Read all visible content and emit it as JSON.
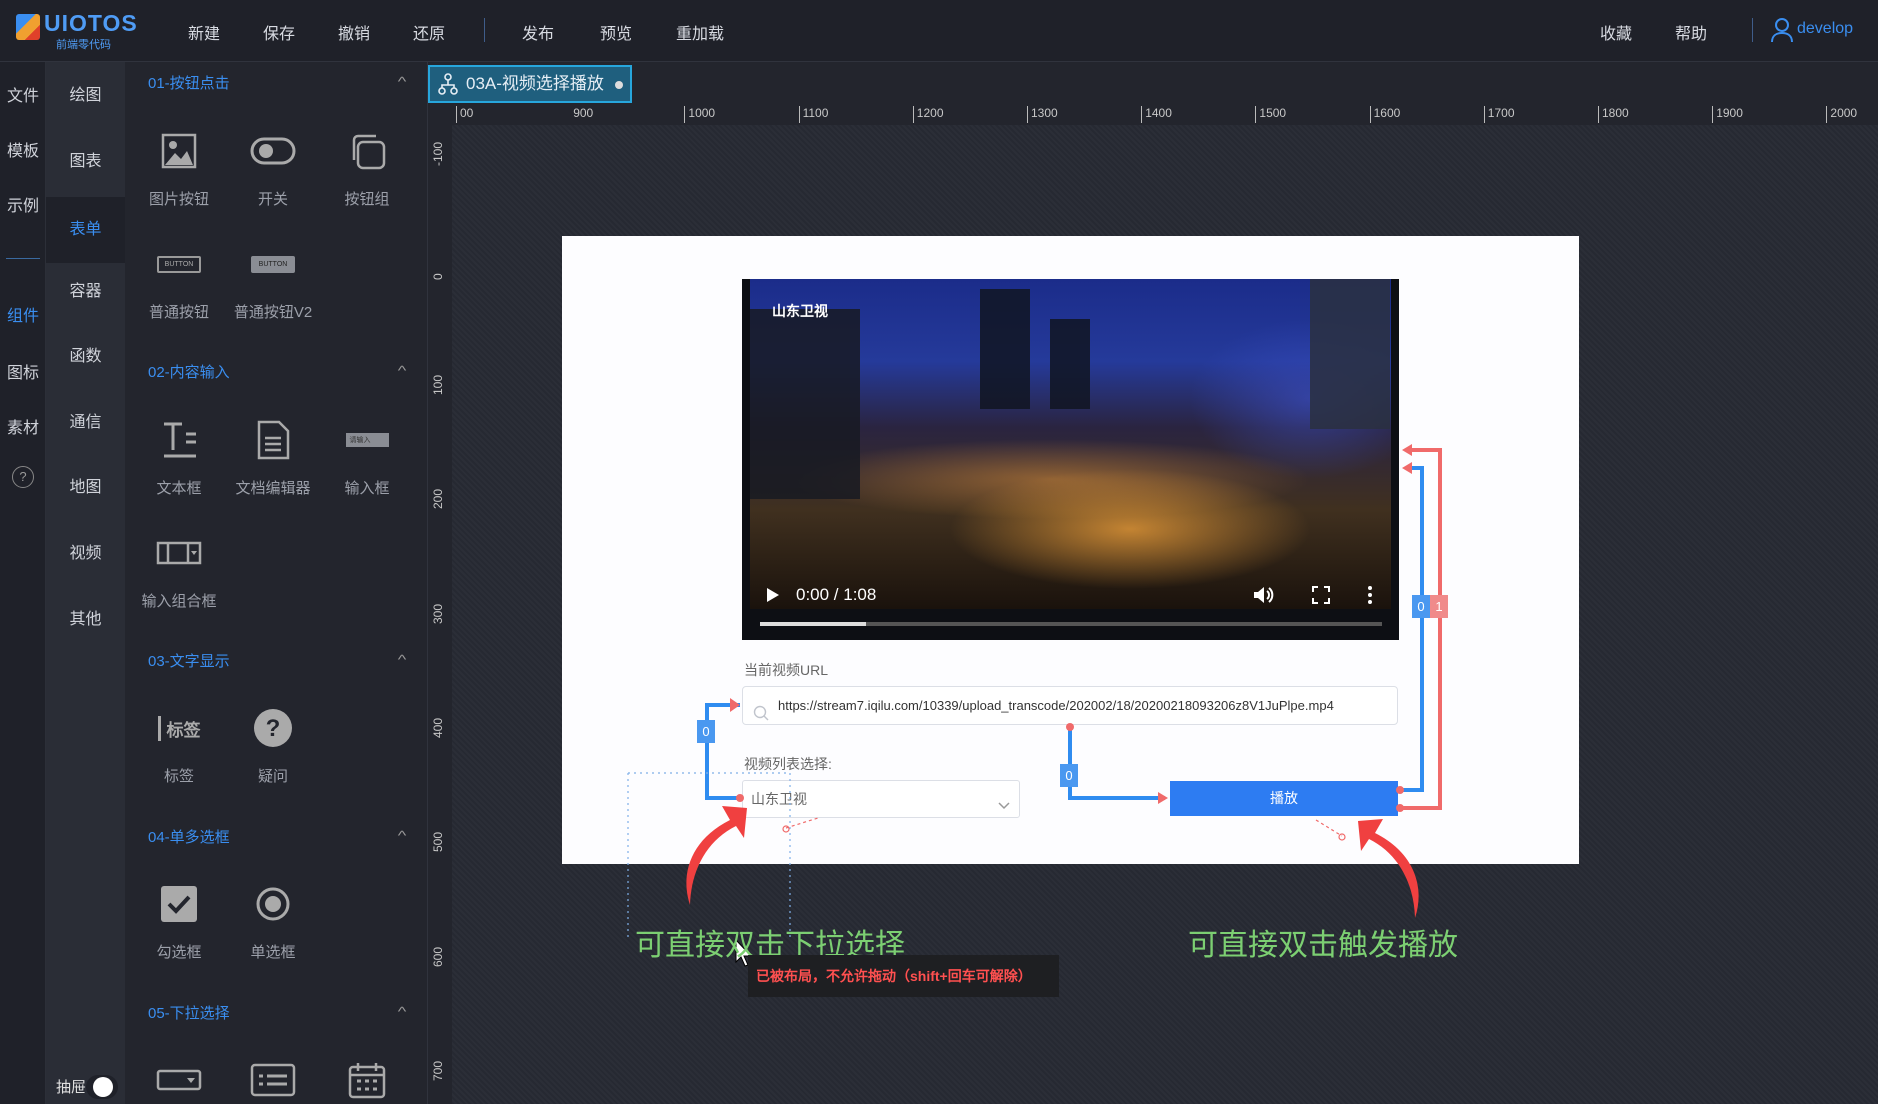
{
  "app": {
    "logo": "UIOTOS",
    "logo_sub": "前端零代码",
    "user": "develop"
  },
  "topmenu": [
    "新建",
    "保存",
    "撤销",
    "还原",
    "发布",
    "预览",
    "重加载"
  ],
  "topright": [
    "收藏",
    "帮助"
  ],
  "col1": [
    {
      "label": "文件"
    },
    {
      "label": "模板"
    },
    {
      "label": "示例"
    },
    {
      "label": "组件",
      "active": true
    },
    {
      "label": "图标"
    },
    {
      "label": "素材"
    },
    {
      "label": "?"
    }
  ],
  "col2": [
    {
      "label": "绘图"
    },
    {
      "label": "图表"
    },
    {
      "label": "表单",
      "active": true
    },
    {
      "label": "容器"
    },
    {
      "label": "函数"
    },
    {
      "label": "通信"
    },
    {
      "label": "地图"
    },
    {
      "label": "视频"
    },
    {
      "label": "其他"
    }
  ],
  "drawer": {
    "label": "抽屉",
    "on": true
  },
  "panel": {
    "sections": [
      {
        "title": "01-按钮点击",
        "items": [
          {
            "label": "图片按钮",
            "icon": "image-icon"
          },
          {
            "label": "开关",
            "icon": "toggle-icon"
          },
          {
            "label": "按钮组",
            "icon": "copy-icon"
          },
          {
            "label": "普通按钮",
            "icon": "button-icon",
            "text": "BUTTON"
          },
          {
            "label": "普通按钮V2",
            "icon": "button-filled-icon",
            "text": "BUTTON"
          }
        ]
      },
      {
        "title": "02-内容输入",
        "items": [
          {
            "label": "文本框",
            "icon": "text-icon"
          },
          {
            "label": "文档编辑器",
            "icon": "document-icon"
          },
          {
            "label": "输入框",
            "icon": "input-icon",
            "text": "请输入"
          },
          {
            "label": "输入组合框",
            "icon": "combo-input-icon"
          }
        ]
      },
      {
        "title": "03-文字显示",
        "items": [
          {
            "label": "标签",
            "icon": "label-icon",
            "text": "标签"
          },
          {
            "label": "疑问",
            "icon": "question-icon"
          }
        ]
      },
      {
        "title": "04-单多选框",
        "items": [
          {
            "label": "勾选框",
            "icon": "checkbox-icon"
          },
          {
            "label": "单选框",
            "icon": "radio-icon"
          }
        ]
      },
      {
        "title": "05-下拉选择",
        "items": [
          {
            "label": "",
            "icon": "dropdown-icon"
          },
          {
            "label": "",
            "icon": "list-icon"
          },
          {
            "label": "",
            "icon": "calendar-icon"
          }
        ]
      }
    ]
  },
  "tab": {
    "title": "03A-视频选择播放",
    "modified": true
  },
  "ruler": {
    "h": [
      "00",
      "900",
      "1000",
      "1100",
      "1200",
      "1300",
      "1400",
      "1500",
      "1600",
      "1700",
      "1800",
      "1900",
      "2000"
    ],
    "v": [
      "-100",
      "0",
      "100",
      "200",
      "300",
      "400",
      "500",
      "600",
      "700"
    ]
  },
  "video": {
    "watermark": "山东卫视",
    "time": "0:00 / 1:08",
    "progress": 0.17
  },
  "url": {
    "label": "当前视频URL",
    "value": "https://stream7.iqilu.com/10339/upload_transcode/202002/18/20200218093206z8V1JuPlpe.mp4"
  },
  "select": {
    "label": "视频列表选择:",
    "value": "山东卫视"
  },
  "play_button": "播放",
  "links": {
    "badge_url": "0",
    "badge_select": "0",
    "badge_play0": "0",
    "badge_play1": "1"
  },
  "annotations": {
    "left": "可直接双击下拉选择",
    "right": "可直接双击触发播放"
  },
  "tooltip": "已被布局，不允许拖动（shift+回车可解除）",
  "colors": {
    "accent": "#3a8ef0",
    "button": "#2d7cf2",
    "link_blue": "#2f8cf0",
    "link_red": "#f06a6a",
    "annotation": "#7ccf72",
    "tooltip_text": "#ff5050"
  }
}
